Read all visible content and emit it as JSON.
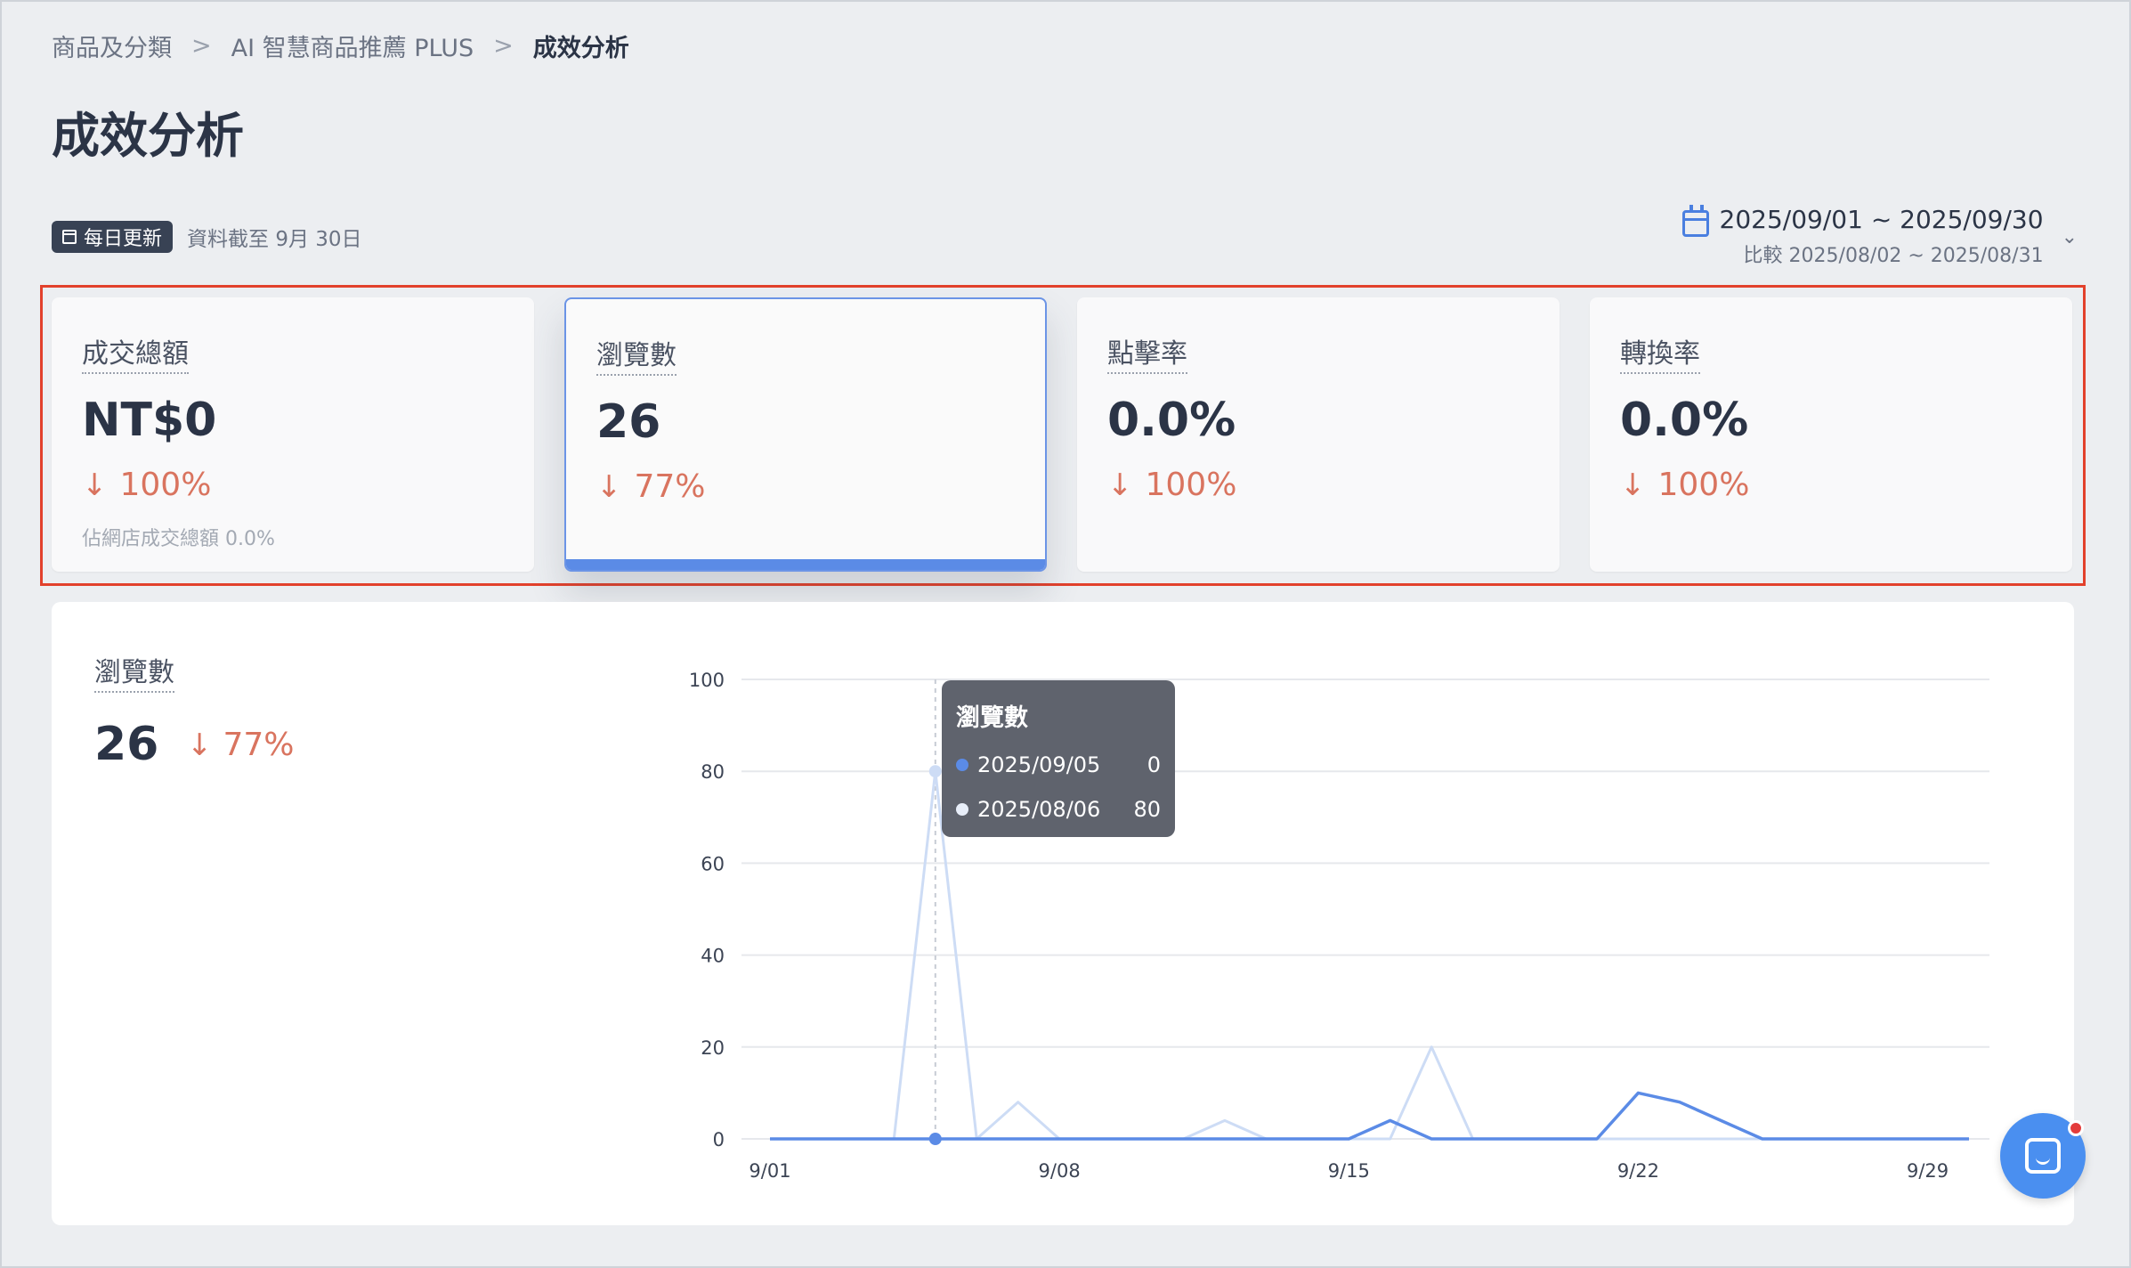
{
  "breadcrumb": {
    "items": [
      "商品及分類",
      "AI 智慧商品推薦 PLUS"
    ],
    "current": "成效分析",
    "separator": ">"
  },
  "page": {
    "title": "成效分析"
  },
  "update": {
    "badge": "每日更新",
    "note": "資料截至 9月 30日"
  },
  "date_range": {
    "main": "2025/09/01 ~ 2025/09/30",
    "compare": "比較 2025/08/02 ~ 2025/08/31",
    "chevron": "⌄"
  },
  "kpis": [
    {
      "label": "成交總額",
      "value": "NT$0",
      "arrow": "↓",
      "change": "100%",
      "sub": "佔網店成交總額 0.0%"
    },
    {
      "label": "瀏覽數",
      "value": "26",
      "arrow": "↓",
      "change": "77%",
      "sub": ""
    },
    {
      "label": "點擊率",
      "value": "0.0%",
      "arrow": "↓",
      "change": "100%",
      "sub": ""
    },
    {
      "label": "轉換率",
      "value": "0.0%",
      "arrow": "↓",
      "change": "100%",
      "sub": ""
    }
  ],
  "panel": {
    "label": "瀏覽數",
    "value": "26",
    "arrow": "↓",
    "change": "77%"
  },
  "tooltip": {
    "title": "瀏覽數",
    "rows": [
      {
        "date": "2025/09/05",
        "value": "0",
        "color": "#5b8be6"
      },
      {
        "date": "2025/08/06",
        "value": "80",
        "color": "#d6e3f8"
      }
    ]
  },
  "colors": {
    "current": "#5b8be6",
    "compare": "#cddcf5",
    "decrease": "#d9745f",
    "outline": "#e2412c"
  },
  "chart_data": {
    "type": "line",
    "x": [
      1,
      2,
      3,
      4,
      5,
      6,
      7,
      8,
      9,
      10,
      11,
      12,
      13,
      14,
      15,
      16,
      17,
      18,
      19,
      20,
      21,
      22,
      23,
      24,
      25,
      26,
      27,
      28,
      29,
      30
    ],
    "x_tick_labels": [
      "9/01",
      "9/08",
      "9/15",
      "9/22",
      "9/29"
    ],
    "x_tick_positions": [
      1,
      8,
      15,
      22,
      29
    ],
    "y_ticks": [
      0,
      20,
      40,
      60,
      80,
      100
    ],
    "ylim": [
      0,
      100
    ],
    "series": [
      {
        "key": "current",
        "values": [
          0,
          0,
          0,
          0,
          0,
          0,
          0,
          0,
          0,
          0,
          0,
          0,
          0,
          0,
          0,
          4,
          0,
          0,
          0,
          0,
          0,
          10,
          8,
          4,
          0,
          0,
          0,
          0,
          0,
          0
        ]
      },
      {
        "key": "compare",
        "values": [
          0,
          0,
          0,
          0,
          80,
          0,
          8,
          0,
          0,
          0,
          0,
          4,
          0,
          0,
          0,
          0,
          20,
          0,
          0,
          0,
          0,
          0,
          0,
          0,
          0,
          0,
          0,
          0,
          0,
          0
        ]
      }
    ],
    "highlight_index": 4,
    "grid": true
  },
  "icons": {
    "calendar": "calendar-icon",
    "chat": "chat-icon"
  }
}
